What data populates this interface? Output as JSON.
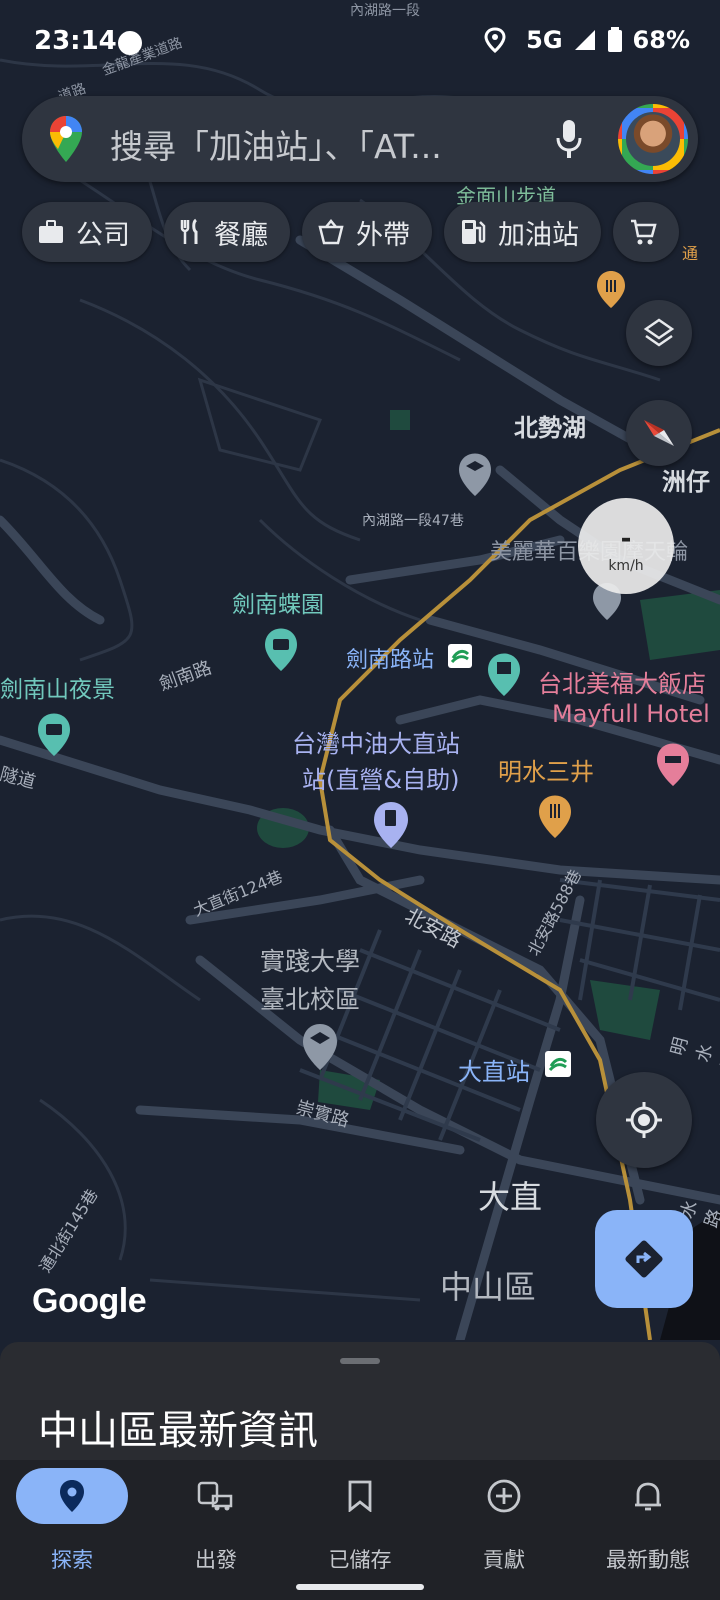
{
  "status": {
    "time": "23:14",
    "network": "5G",
    "battery": "68%"
  },
  "search": {
    "placeholder": "搜尋「加油站」、「AT..."
  },
  "chips": [
    {
      "label": "公司",
      "icon": "briefcase-icon"
    },
    {
      "label": "餐廳",
      "icon": "restaurant-icon"
    },
    {
      "label": "外帶",
      "icon": "takeout-icon"
    },
    {
      "label": "加油站",
      "icon": "gas-station-icon"
    },
    {
      "label": "",
      "icon": "shopping-cart-icon"
    }
  ],
  "map": {
    "labels": {
      "gold_road": "金龍產業道路",
      "road_nw": "道路",
      "neihu_top": "內湖路一段",
      "trail": "金面山步道",
      "beishihu": "北勢湖",
      "zhouzai": "洲仔",
      "neihu_47": "內湖路一段47巷",
      "miramar": "美麗華百樂園摩天輪",
      "jiannan_butterfly": "劍南蝶園",
      "jiannan_station": "劍南路站",
      "jiannan_night": "劍南山夜景",
      "jiannan_road": "劍南路",
      "tunnel": "隧道",
      "cpc_1": "台灣中油大直站",
      "cpc_2": "站(直營&自助)",
      "mingshui": "明水三井",
      "mayfull_zh": "台北美福大飯店",
      "mayfull_en": "Mayfull Hotel",
      "dazhi_124": "大直街124巷",
      "beian": "北安路",
      "beian_588": "北安路588巷",
      "usc_1": "實踐大學",
      "usc_2": "臺北校區",
      "dazhi_station": "大直站",
      "chongshi": "崇實路",
      "dazhi": "大直",
      "zhongshan": "中山區",
      "tongbei_145": "通北街145巷",
      "mingshui_rd": "明水路",
      "shui_rd": "水路",
      "tong_rd": "通"
    }
  },
  "speed": {
    "value": "-",
    "unit": "km/h"
  },
  "google_logo": "Google",
  "sheet": {
    "title": "中山區最新資訊"
  },
  "nav": [
    {
      "label": "探索",
      "icon": "explore-pin-icon",
      "active": true
    },
    {
      "label": "出發",
      "icon": "commute-icon",
      "active": false
    },
    {
      "label": "已儲存",
      "icon": "bookmark-icon",
      "active": false
    },
    {
      "label": "貢獻",
      "icon": "add-circle-icon",
      "active": false
    },
    {
      "label": "最新動態",
      "icon": "bell-icon",
      "active": false
    }
  ],
  "colors": {
    "map_bg": "#1b2230",
    "road": "#3b4658",
    "highway": "#b8903a",
    "park": "#1f4a3e",
    "accent": "#8ab4f8",
    "hotel": "#e57e9a",
    "food": "#e0a04a"
  }
}
